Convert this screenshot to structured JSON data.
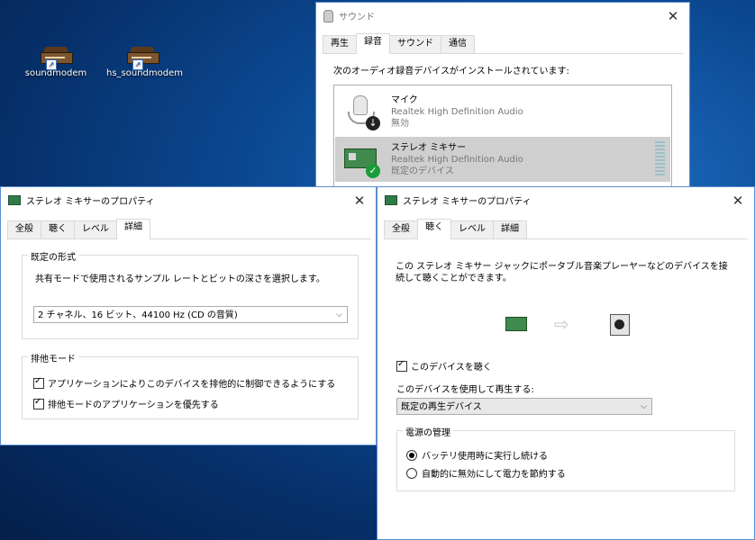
{
  "desktop": {
    "icons": [
      {
        "label": "soundmodem"
      },
      {
        "label": "hs_soundmodem"
      }
    ]
  },
  "sound_window": {
    "title": "サウンド",
    "tabs": [
      "再生",
      "録音",
      "サウンド",
      "通信"
    ],
    "active_tab": "録音",
    "instruction": "次のオーディオ録音デバイスがインストールされています:",
    "devices": [
      {
        "name": "マイク",
        "driver": "Realtek High Definition Audio",
        "status": "無効",
        "status_icon": "down-arrow-icon"
      },
      {
        "name": "ステレオ ミキサー",
        "driver": "Realtek High Definition Audio",
        "status": "既定のデバイス",
        "status_icon": "green-check-icon",
        "selected": true
      }
    ]
  },
  "props_left": {
    "title": "ステレオ ミキサーのプロパティ",
    "tabs": [
      "全般",
      "聴く",
      "レベル",
      "詳細"
    ],
    "active_tab": "詳細",
    "default_format": {
      "legend": "既定の形式",
      "description": "共有モードで使用されるサンプル レートとビットの深さを選択します。",
      "selected": "2 チャネル、16 ビット、44100 Hz (CD の音質)"
    },
    "exclusive": {
      "legend": "排他モード",
      "options": [
        {
          "label": "アプリケーションによりこのデバイスを排他的に制御できるようにする",
          "checked": true
        },
        {
          "label": "排他モードのアプリケーションを優先する",
          "checked": true
        }
      ]
    }
  },
  "props_right": {
    "title": "ステレオ ミキサーのプロパティ",
    "tabs": [
      "全般",
      "聴く",
      "レベル",
      "詳細"
    ],
    "active_tab": "聴く",
    "description": "この ステレオ ミキサー ジャックにポータブル音楽プレーヤーなどのデバイスを接続して聴くことができます。",
    "listen_checkbox": {
      "label": "このデバイスを聴く",
      "checked": true
    },
    "playback_label": "このデバイスを使用して再生する:",
    "playback_selected": "既定の再生デバイス",
    "power": {
      "legend": "電源の管理",
      "options": [
        {
          "label": "バッテリ使用時に実行し続ける",
          "selected": true
        },
        {
          "label": "自動的に無効にして電力を節約する",
          "selected": false
        }
      ]
    }
  },
  "close_glyph": "✕"
}
